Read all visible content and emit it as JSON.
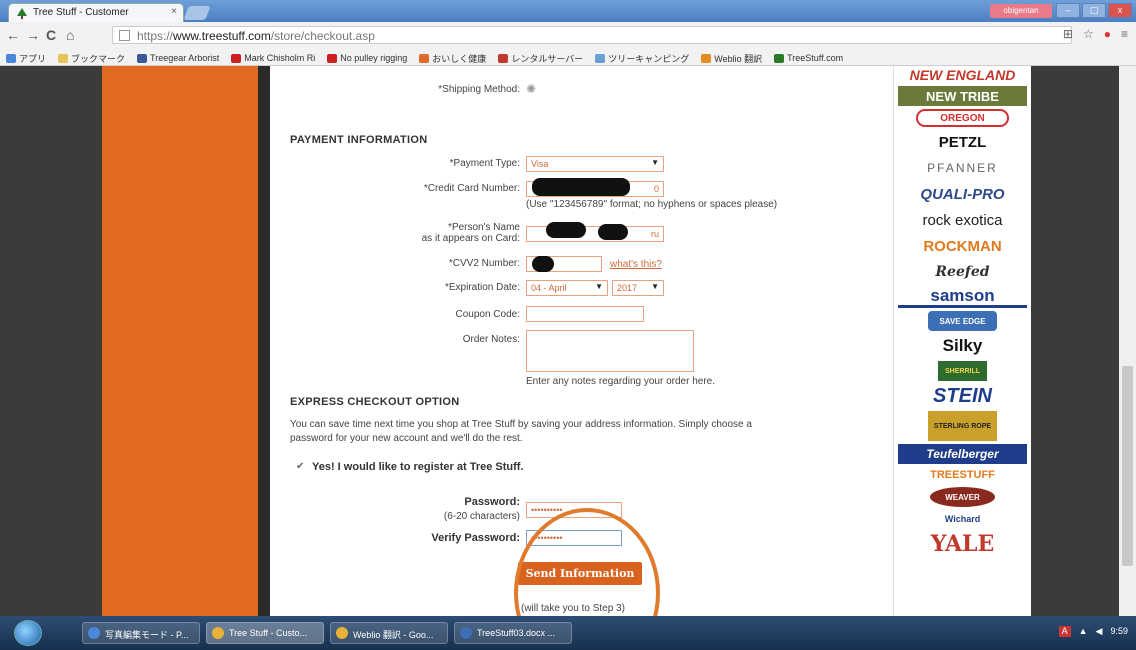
{
  "browser": {
    "tab_title": "Tree Stuff - Customer",
    "tab_close": "×",
    "user_label": "obigentan",
    "window_controls": [
      "–",
      "▢",
      "x"
    ],
    "url_prefix": "https://",
    "url_host": "www.treestuff.com",
    "url_path": "/store/checkout.asp"
  },
  "bookmarks": [
    {
      "label": "アプリ",
      "color": "#4a87d8"
    },
    {
      "label": "ブックマーク",
      "color": "#e8c35a"
    },
    {
      "label": "Treegear Arborist",
      "color": "#3b5998"
    },
    {
      "label": "Mark Chisholm Ri",
      "color": "#cc1f1f"
    },
    {
      "label": "No pulley rigging",
      "color": "#cc1f1f"
    },
    {
      "label": "おいしく健康",
      "color": "#e36a2e"
    },
    {
      "label": "レンタルサーバー",
      "color": "#c0392b"
    },
    {
      "label": "ツリーキャンピング",
      "color": "#6aa0d8"
    },
    {
      "label": "Weblio 翻訳",
      "color": "#e38c1f"
    },
    {
      "label": "TreeStuff.com",
      "color": "#2a7a2a"
    }
  ],
  "form": {
    "shipping_method_label": "*Shipping Method:",
    "payment_heading": "PAYMENT INFORMATION",
    "payment_type_label": "*Payment Type:",
    "payment_type_value": "Visa",
    "cc_number_label": "*Credit Card Number:",
    "cc_number_value": "0",
    "cc_hint": "(Use \"123456789\" format; no hyphens or spaces please)",
    "name_label_1": "*Person's Name",
    "name_label_2": "as it appears on Card:",
    "name_value": "ru",
    "cvv_label": "*CVV2 Number:",
    "cvv_link": "what's this?",
    "expiration_label": "*Expiration Date:",
    "expiration_month": "04 - April",
    "expiration_year": "2017",
    "coupon_label": "Coupon Code:",
    "notes_label": "Order Notes:",
    "notes_hint": "Enter any notes regarding your order here.",
    "express_heading": "EXPRESS CHECKOUT OPTION",
    "express_text_1": "You can save time next time you shop at Tree Stuff by saving your address information. Simply choose a",
    "express_text_2": "password for your new account and we'll do the rest.",
    "register_label": "Yes! I would like to register at Tree Stuff.",
    "password_label": "Password:",
    "password_hint": "(6-20 characters)",
    "password_value": "••••••••••",
    "verify_label": "Verify Password:",
    "verify_value": "••••••••••",
    "send_button": "Send Information",
    "send_note": "(will take you to Step 3)"
  },
  "brands": [
    {
      "name": "NEW ENGLAND",
      "color": "#c0392b"
    },
    {
      "name": "NEW TRIBE",
      "color": "#ffffff"
    },
    {
      "name": "OREGON",
      "color": "#d32f2f"
    },
    {
      "name": "PETZL",
      "color": "#111111"
    },
    {
      "name": "PFANNER",
      "color": "#555555"
    },
    {
      "name": "QUALI-PRO",
      "color": "#2e4a8a"
    },
    {
      "name": "rock exotica",
      "color": "#222222"
    },
    {
      "name": "ROCKMAN",
      "color": "#e07a1f"
    },
    {
      "name": "Reefed",
      "color": "#333333"
    },
    {
      "name": "samson",
      "color": "#1f3d8a"
    },
    {
      "name": "SAVE EDGE",
      "color": "#ffffff"
    },
    {
      "name": "Silky",
      "color": "#111111"
    },
    {
      "name": "SHERRILL",
      "color": "#2e6b2e"
    },
    {
      "name": "STEIN",
      "color": "#1f3d8a"
    },
    {
      "name": "STERLING ROPE",
      "color": "#444444"
    },
    {
      "name": "Teufelberger",
      "color": "#ffffff"
    },
    {
      "name": "TREESTUFF",
      "color": "#e07a1f"
    },
    {
      "name": "WEAVER",
      "color": "#ffffff"
    },
    {
      "name": "Wichard",
      "color": "#1f3d8a"
    },
    {
      "name": "YALE",
      "color": "#c0392b"
    }
  ],
  "taskbar": {
    "tasks": [
      "写真編集モード - P...",
      "Tree Stuff - Custo...",
      "Weblio 翻訳 - Goo...",
      "TreeStuff03.docx ..."
    ],
    "clock": "9:59"
  }
}
